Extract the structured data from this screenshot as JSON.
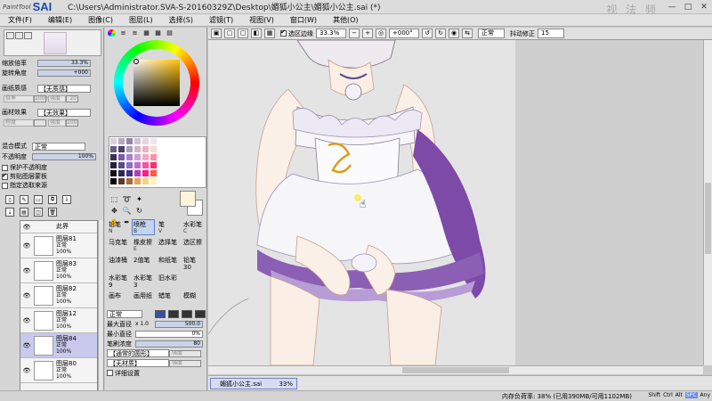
{
  "app": {
    "logo_small": "PaintTool",
    "logo_big": "SAI",
    "path": "C:\\Users\\Administrator.SVA-S-20160329Z\\Desktop\\媚狐小公主\\媚狐小公主.sai (*)",
    "watermark": "视 法 频"
  },
  "menu": [
    "文件(F)",
    "编辑(E)",
    "图像(C)",
    "图层(L)",
    "选择(S)",
    "滤镜(T)",
    "视图(V)",
    "窗口(W)",
    "其他(O)"
  ],
  "navigator": {
    "zoom_label": "缩放倍率",
    "zoom_value": "33.3%",
    "rotate_label": "旋转角度",
    "rotate_value": "+000"
  },
  "paper": {
    "texture_label": "画纸质感",
    "texture_value": "【无质感】",
    "texture_scale_label": "倍率",
    "texture_scale_value": "100%",
    "texture_strength_label": "强度",
    "texture_strength_value": "20",
    "effect_label": "画材效果",
    "effect_value": "【无效果】",
    "effect_width_label": "程度",
    "effect_width_value": "",
    "effect_strength_label": "强度",
    "effect_strength_value": "100"
  },
  "layer_props": {
    "blend_label": "混合模式",
    "blend_value": "正常",
    "opacity_label": "不透明度",
    "opacity_value": "100%",
    "protect_label": "保护不透明度",
    "clip_label": "剪贴图层蒙板",
    "clip_checked": true,
    "source_label": "指定选取来源"
  },
  "layers": [
    {
      "name": "图层81",
      "mode": "正常",
      "opacity": "100%",
      "selected": false
    },
    {
      "name": "图层83",
      "mode": "正常",
      "opacity": "100%",
      "selected": false
    },
    {
      "name": "图层82",
      "mode": "正常",
      "opacity": "100%",
      "selected": false
    },
    {
      "name": "图层12",
      "mode": "正常",
      "opacity": "100%",
      "selected": false
    },
    {
      "name": "图层84",
      "mode": "正常",
      "opacity": "100%",
      "selected": true
    },
    {
      "name": "图层80",
      "mode": "正常",
      "opacity": "100%",
      "selected": false
    }
  ],
  "layer_top_partial": "此界",
  "swatch_colors": [
    "#d7d0dd",
    "#b8a9c3",
    "#9586a6",
    "#cfc3d7",
    "#e7d4e1",
    "#f2e2ea",
    "#ffffff",
    "#ffffff",
    "#ffffff",
    "#ffffff",
    "#ffffff",
    "#ffffff",
    "#6a5d86",
    "#4c3f6a",
    "#a6a0ba",
    "#d2b5c8",
    "#e9b4c4",
    "#fbd7d6",
    "#ffffff",
    "#ffffff",
    "#ffffff",
    "#ffffff",
    "#ffffff",
    "#ffffff",
    "#3c2f53",
    "#7d5aa8",
    "#a684c9",
    "#cf9ed4",
    "#f3a7c2",
    "#ff8fae",
    "#ffffff",
    "#ffffff",
    "#ffffff",
    "#ffffff",
    "#ffffff",
    "#ffffff",
    "#22213a",
    "#564b8c",
    "#8d6fbd",
    "#c06cc2",
    "#ff4fa0",
    "#ff2d6c",
    "#ffffff",
    "#ffffff",
    "#ffffff",
    "#ffffff",
    "#ffffff",
    "#ffffff",
    "#101010",
    "#2a2a5a",
    "#472f8a",
    "#b03fb0",
    "#ff1a8a",
    "#ff5a3c",
    "#ffffff",
    "#ffffff",
    "#ffffff",
    "#ffffff",
    "#ffffff",
    "#ffffff",
    "#000000",
    "#5b3a2a",
    "#a06a3c",
    "#e8a25a",
    "#f6d37c",
    "#fff3b8",
    "#ffffff",
    "#ffffff",
    "#ffffff",
    "#ffffff",
    "#ffffff",
    "#ffffff"
  ],
  "brushes": [
    {
      "name": "铅笔",
      "key": "N",
      "active": false
    },
    {
      "name": "喷枪",
      "key": "B",
      "active": true
    },
    {
      "name": "笔",
      "key": "V",
      "active": false
    },
    {
      "name": "水彩笔",
      "key": "C",
      "active": false
    },
    {
      "name": "马克笔",
      "key": "",
      "active": false
    },
    {
      "name": "橡皮擦",
      "key": "E",
      "active": false
    },
    {
      "name": "选择笔",
      "key": "",
      "active": false
    },
    {
      "name": "选区擦",
      "key": "",
      "active": false
    },
    {
      "name": "油漆桶",
      "key": "",
      "active": false
    },
    {
      "name": "2值笔",
      "key": "",
      "active": false
    },
    {
      "name": "和纸笔",
      "key": "",
      "active": false
    },
    {
      "name": "铅笔30",
      "key": "",
      "active": false
    },
    {
      "name": "水彩笔9",
      "key": "",
      "active": false
    },
    {
      "name": "水彩笔3",
      "key": "",
      "active": false
    },
    {
      "name": "旧水彩",
      "key": "",
      "active": false
    },
    {
      "name": "",
      "key": "",
      "active": false
    },
    {
      "name": "画布",
      "key": "",
      "active": false
    },
    {
      "name": "画用纸",
      "key": "",
      "active": false
    },
    {
      "name": "蜡笔",
      "key": "",
      "active": false
    },
    {
      "name": "模糊",
      "key": "",
      "active": false
    }
  ],
  "brush_props": {
    "mode_value": "正常",
    "max_size_label": "最大直径",
    "max_size_mult": "x 1.0",
    "max_size_value": "500.0",
    "min_size_label": "最小直径",
    "min_size_value": "0%",
    "density_label": "笔刷浓度",
    "density_value": "80",
    "shape_value": "【通常的圆形】",
    "shape_strength": "强度",
    "texture_value": "【无材质】",
    "texture_strength": "强度",
    "detail_label": "详细设置"
  },
  "canvas_toolbar": {
    "selection_edge_label": "选区边缘",
    "zoom_value": "33.3%",
    "rotation_value": "+000°",
    "blend_value": "正常",
    "stabilizer_label": "抖动修正",
    "stabilizer_value": "15"
  },
  "doc_tab": {
    "filename": "媚狐小公主.sai",
    "zoom": "33%"
  },
  "status": {
    "memory": "内存负荷率: 38% (已用390MB/可用1102MB)",
    "keys": [
      "Shift",
      "Ctrl",
      "Alt",
      "SPC",
      "Any"
    ]
  }
}
